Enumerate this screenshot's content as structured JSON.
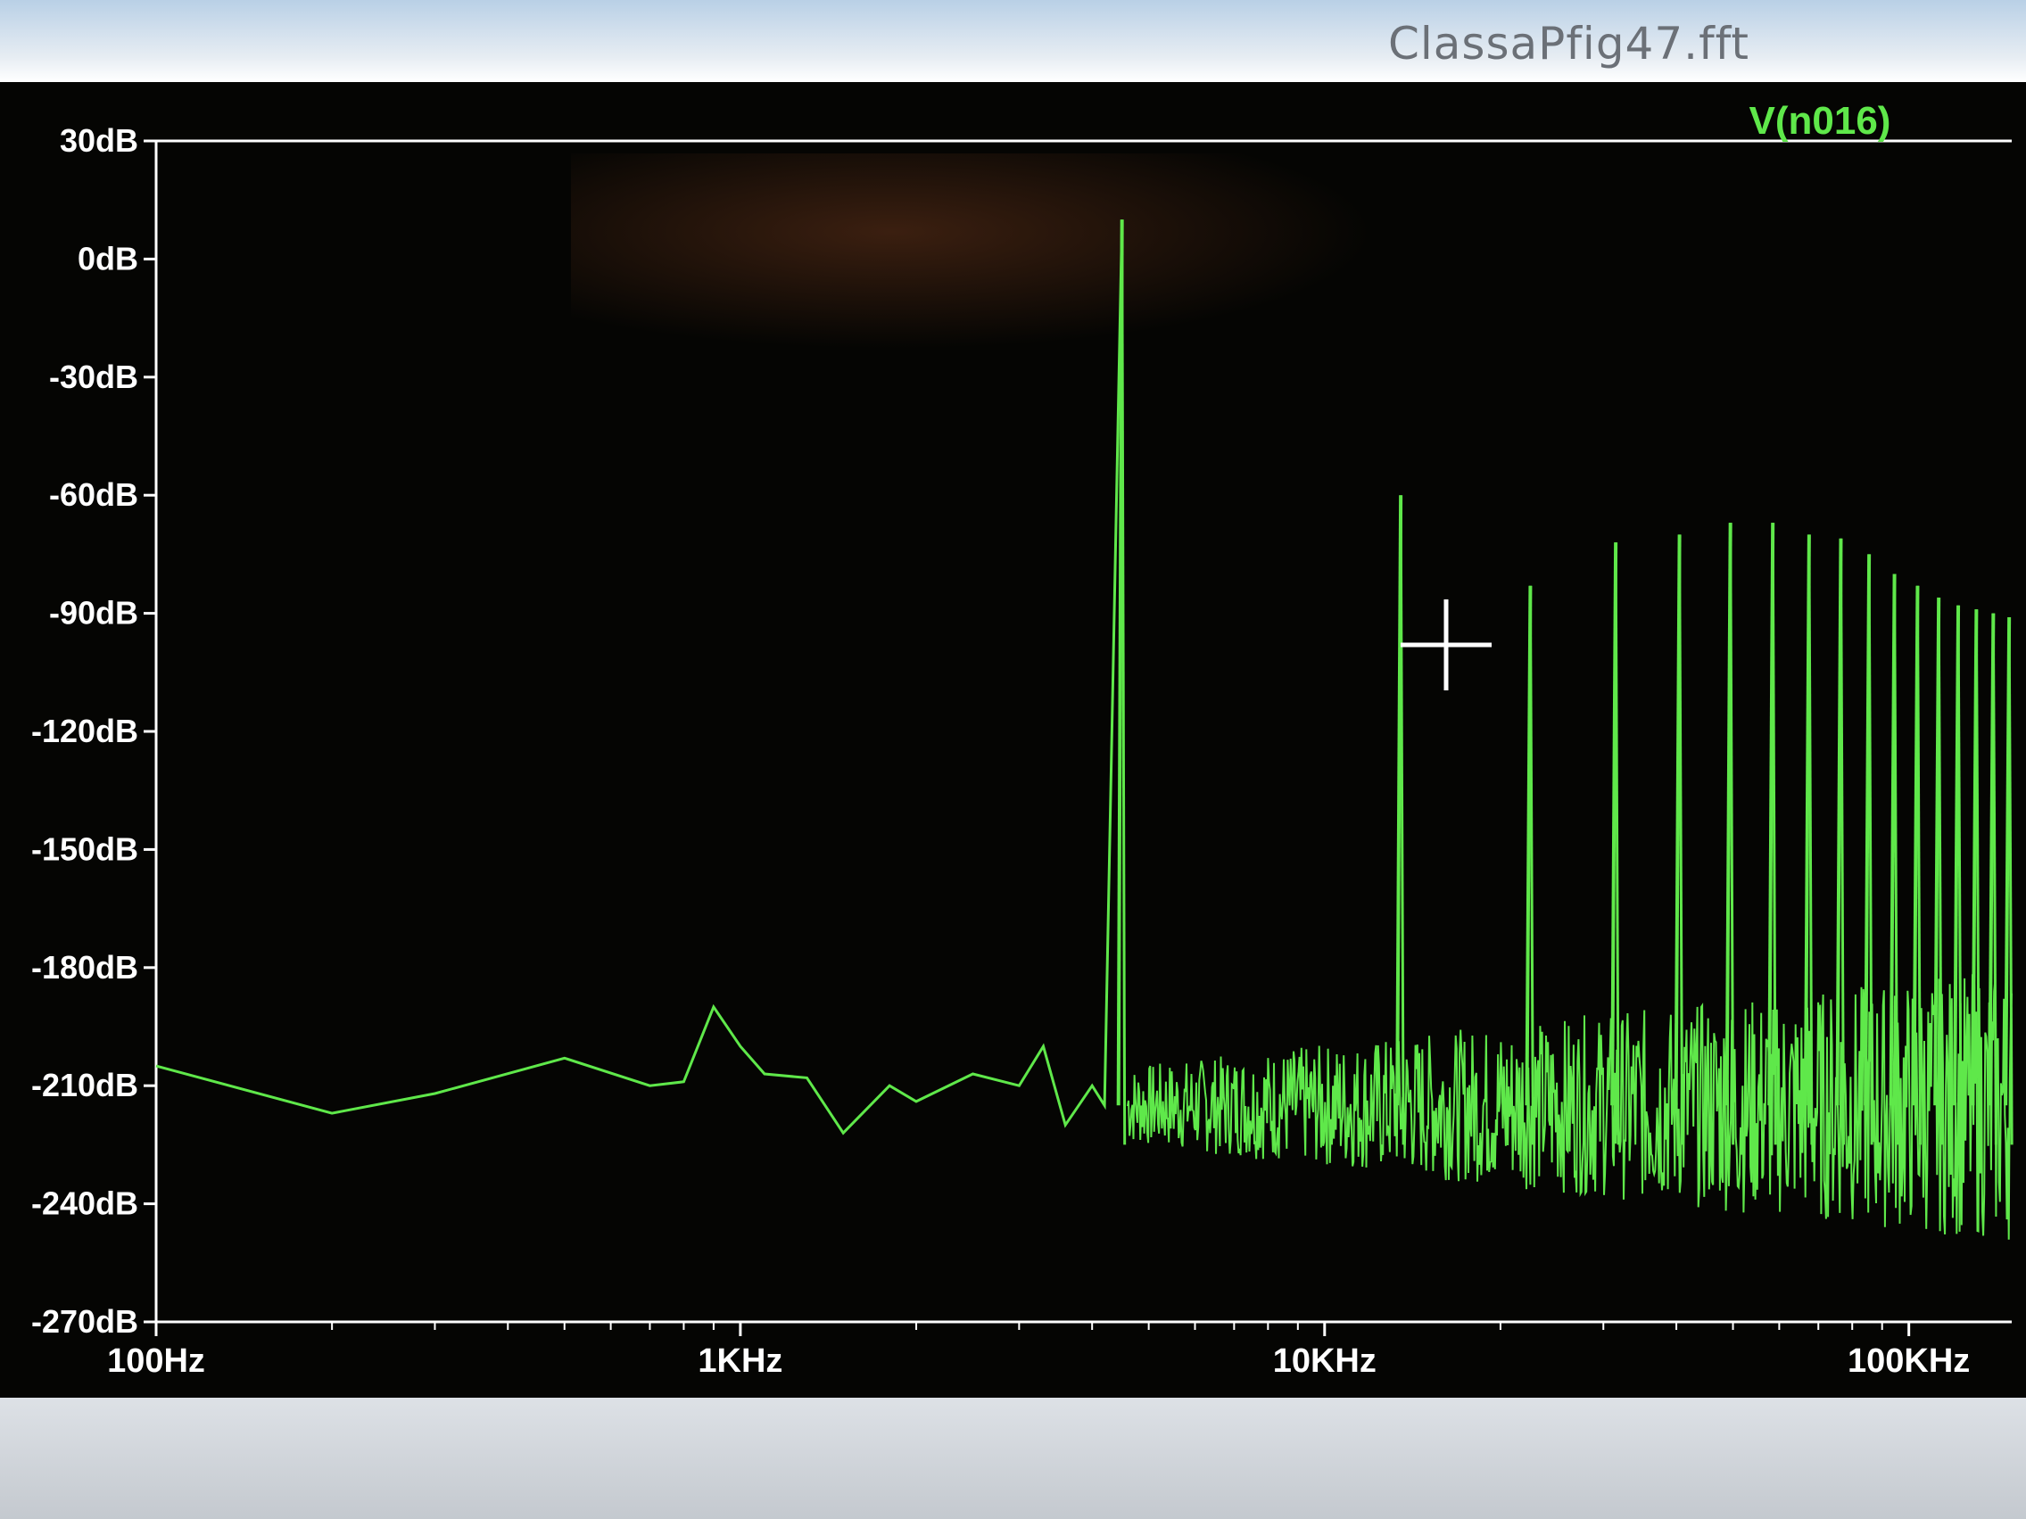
{
  "window": {
    "title": "ClassaPfig47.fft"
  },
  "colors": {
    "trace": "#5fe84a",
    "axes": "#ffffff",
    "background": "#050503",
    "cursor": "#ffffff"
  },
  "chart_data": {
    "type": "line",
    "title": "",
    "trace_label": "V(n016)",
    "x_scale": "log",
    "xlim": [
      100,
      150000
    ],
    "ylim": [
      -270,
      30
    ],
    "x_ticks": [
      {
        "value": 100,
        "label": "100Hz"
      },
      {
        "value": 1000,
        "label": "1KHz"
      },
      {
        "value": 10000,
        "label": "10KHz"
      },
      {
        "value": 100000,
        "label": "100KHz"
      }
    ],
    "y_ticks": [
      {
        "value": 30,
        "label": "30dB"
      },
      {
        "value": 0,
        "label": "0dB"
      },
      {
        "value": -30,
        "label": "-30dB"
      },
      {
        "value": -60,
        "label": "-60dB"
      },
      {
        "value": -90,
        "label": "-90dB"
      },
      {
        "value": -120,
        "label": "-120dB"
      },
      {
        "value": -150,
        "label": "-150dB"
      },
      {
        "value": -180,
        "label": "-180dB"
      },
      {
        "value": -210,
        "label": "-210dB"
      },
      {
        "value": -240,
        "label": "-240dB"
      },
      {
        "value": -270,
        "label": "-270dB"
      }
    ],
    "noise_floor_db": -215,
    "series": [
      {
        "name": "V(n016)",
        "x": [
          100,
          200,
          300,
          500,
          700,
          800,
          900,
          1000,
          1100,
          1300,
          1500,
          1800,
          2000,
          2500,
          3000,
          3300,
          3600,
          4000,
          4200,
          4500
        ],
        "y": [
          -205,
          -217,
          -212,
          -203,
          -210,
          -209,
          -190,
          -200,
          -207,
          -208,
          -222,
          -210,
          -214,
          -207,
          -210,
          -200,
          -220,
          -210,
          -215,
          10
        ]
      }
    ],
    "peaks": [
      {
        "x": 4500,
        "y": 10
      },
      {
        "x": 13500,
        "y": -60
      },
      {
        "x": 22500,
        "y": -83
      },
      {
        "x": 31500,
        "y": -72
      },
      {
        "x": 40500,
        "y": -70
      },
      {
        "x": 49500,
        "y": -67
      },
      {
        "x": 58500,
        "y": -67
      },
      {
        "x": 67500,
        "y": -70
      },
      {
        "x": 76500,
        "y": -71
      },
      {
        "x": 85500,
        "y": -75
      },
      {
        "x": 94500,
        "y": -80
      },
      {
        "x": 103500,
        "y": -83
      },
      {
        "x": 112500,
        "y": -86
      },
      {
        "x": 121500,
        "y": -88
      },
      {
        "x": 130500,
        "y": -89
      },
      {
        "x": 139500,
        "y": -90
      },
      {
        "x": 148500,
        "y": -91
      }
    ]
  }
}
